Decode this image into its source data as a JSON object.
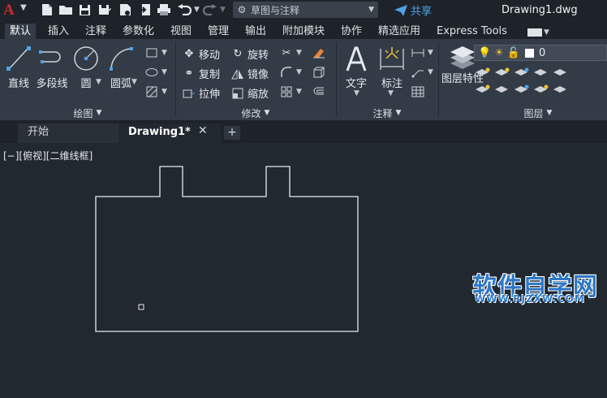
{
  "app": {
    "logo": "A",
    "document_title": "Drawing1.dwg"
  },
  "workspace": {
    "label": "草图与注释"
  },
  "share_label": "共享",
  "ribbon_tabs": [
    "默认",
    "插入",
    "注释",
    "参数化",
    "视图",
    "管理",
    "输出",
    "附加模块",
    "协作",
    "精选应用",
    "Express Tools"
  ],
  "panels": {
    "draw": {
      "title": "绘图",
      "tools": {
        "line": "直线",
        "polyline": "多段线",
        "circle": "圆",
        "arc": "圆弧"
      }
    },
    "modify": {
      "title": "修改",
      "tools": {
        "move": "移动",
        "rotate": "旋转",
        "copy": "复制",
        "mirror": "镜像",
        "stretch": "拉伸",
        "scale": "缩放"
      }
    },
    "annotation": {
      "title": "注释",
      "tools": {
        "text": "文字",
        "dimension": "标注"
      }
    },
    "layers": {
      "title": "图层",
      "layer_properties": "图层特性",
      "current_layer": "0"
    }
  },
  "doc_tabs": {
    "start": "开始",
    "current": "Drawing1*"
  },
  "viewport_label": "[−][俯视][二维线框]",
  "watermark": {
    "title": "软件自学网",
    "url": "WWW.RJZXW.COM"
  },
  "colors": {
    "background": "#212830",
    "ribbon": "#333b46",
    "accent": "#4ea3e6",
    "logo": "#d2272b"
  }
}
